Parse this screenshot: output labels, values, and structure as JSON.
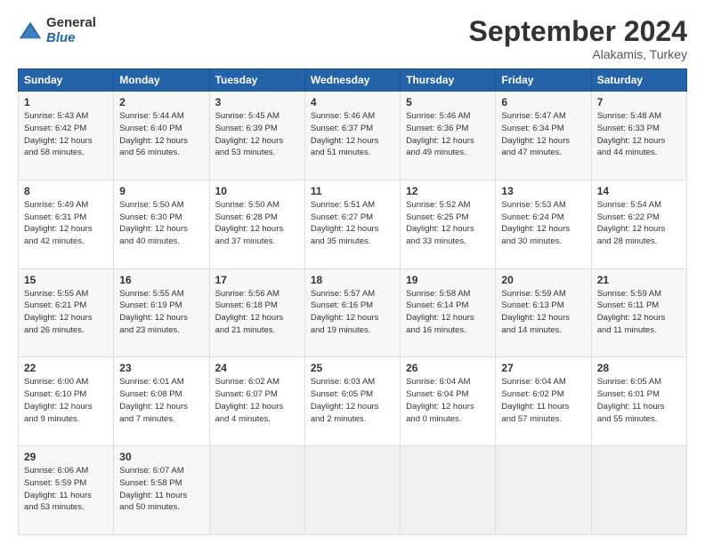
{
  "header": {
    "logo_general": "General",
    "logo_blue": "Blue",
    "month": "September 2024",
    "location": "Alakamis, Turkey"
  },
  "columns": [
    "Sunday",
    "Monday",
    "Tuesday",
    "Wednesday",
    "Thursday",
    "Friday",
    "Saturday"
  ],
  "weeks": [
    [
      {
        "day": "1",
        "lines": [
          "Sunrise: 5:43 AM",
          "Sunset: 6:42 PM",
          "Daylight: 12 hours",
          "and 58 minutes."
        ]
      },
      {
        "day": "2",
        "lines": [
          "Sunrise: 5:44 AM",
          "Sunset: 6:40 PM",
          "Daylight: 12 hours",
          "and 56 minutes."
        ]
      },
      {
        "day": "3",
        "lines": [
          "Sunrise: 5:45 AM",
          "Sunset: 6:39 PM",
          "Daylight: 12 hours",
          "and 53 minutes."
        ]
      },
      {
        "day": "4",
        "lines": [
          "Sunrise: 5:46 AM",
          "Sunset: 6:37 PM",
          "Daylight: 12 hours",
          "and 51 minutes."
        ]
      },
      {
        "day": "5",
        "lines": [
          "Sunrise: 5:46 AM",
          "Sunset: 6:36 PM",
          "Daylight: 12 hours",
          "and 49 minutes."
        ]
      },
      {
        "day": "6",
        "lines": [
          "Sunrise: 5:47 AM",
          "Sunset: 6:34 PM",
          "Daylight: 12 hours",
          "and 47 minutes."
        ]
      },
      {
        "day": "7",
        "lines": [
          "Sunrise: 5:48 AM",
          "Sunset: 6:33 PM",
          "Daylight: 12 hours",
          "and 44 minutes."
        ]
      }
    ],
    [
      {
        "day": "8",
        "lines": [
          "Sunrise: 5:49 AM",
          "Sunset: 6:31 PM",
          "Daylight: 12 hours",
          "and 42 minutes."
        ]
      },
      {
        "day": "9",
        "lines": [
          "Sunrise: 5:50 AM",
          "Sunset: 6:30 PM",
          "Daylight: 12 hours",
          "and 40 minutes."
        ]
      },
      {
        "day": "10",
        "lines": [
          "Sunrise: 5:50 AM",
          "Sunset: 6:28 PM",
          "Daylight: 12 hours",
          "and 37 minutes."
        ]
      },
      {
        "day": "11",
        "lines": [
          "Sunrise: 5:51 AM",
          "Sunset: 6:27 PM",
          "Daylight: 12 hours",
          "and 35 minutes."
        ]
      },
      {
        "day": "12",
        "lines": [
          "Sunrise: 5:52 AM",
          "Sunset: 6:25 PM",
          "Daylight: 12 hours",
          "and 33 minutes."
        ]
      },
      {
        "day": "13",
        "lines": [
          "Sunrise: 5:53 AM",
          "Sunset: 6:24 PM",
          "Daylight: 12 hours",
          "and 30 minutes."
        ]
      },
      {
        "day": "14",
        "lines": [
          "Sunrise: 5:54 AM",
          "Sunset: 6:22 PM",
          "Daylight: 12 hours",
          "and 28 minutes."
        ]
      }
    ],
    [
      {
        "day": "15",
        "lines": [
          "Sunrise: 5:55 AM",
          "Sunset: 6:21 PM",
          "Daylight: 12 hours",
          "and 26 minutes."
        ]
      },
      {
        "day": "16",
        "lines": [
          "Sunrise: 5:55 AM",
          "Sunset: 6:19 PM",
          "Daylight: 12 hours",
          "and 23 minutes."
        ]
      },
      {
        "day": "17",
        "lines": [
          "Sunrise: 5:56 AM",
          "Sunset: 6:18 PM",
          "Daylight: 12 hours",
          "and 21 minutes."
        ]
      },
      {
        "day": "18",
        "lines": [
          "Sunrise: 5:57 AM",
          "Sunset: 6:16 PM",
          "Daylight: 12 hours",
          "and 19 minutes."
        ]
      },
      {
        "day": "19",
        "lines": [
          "Sunrise: 5:58 AM",
          "Sunset: 6:14 PM",
          "Daylight: 12 hours",
          "and 16 minutes."
        ]
      },
      {
        "day": "20",
        "lines": [
          "Sunrise: 5:59 AM",
          "Sunset: 6:13 PM",
          "Daylight: 12 hours",
          "and 14 minutes."
        ]
      },
      {
        "day": "21",
        "lines": [
          "Sunrise: 5:59 AM",
          "Sunset: 6:11 PM",
          "Daylight: 12 hours",
          "and 11 minutes."
        ]
      }
    ],
    [
      {
        "day": "22",
        "lines": [
          "Sunrise: 6:00 AM",
          "Sunset: 6:10 PM",
          "Daylight: 12 hours",
          "and 9 minutes."
        ]
      },
      {
        "day": "23",
        "lines": [
          "Sunrise: 6:01 AM",
          "Sunset: 6:08 PM",
          "Daylight: 12 hours",
          "and 7 minutes."
        ]
      },
      {
        "day": "24",
        "lines": [
          "Sunrise: 6:02 AM",
          "Sunset: 6:07 PM",
          "Daylight: 12 hours",
          "and 4 minutes."
        ]
      },
      {
        "day": "25",
        "lines": [
          "Sunrise: 6:03 AM",
          "Sunset: 6:05 PM",
          "Daylight: 12 hours",
          "and 2 minutes."
        ]
      },
      {
        "day": "26",
        "lines": [
          "Sunrise: 6:04 AM",
          "Sunset: 6:04 PM",
          "Daylight: 12 hours",
          "and 0 minutes."
        ]
      },
      {
        "day": "27",
        "lines": [
          "Sunrise: 6:04 AM",
          "Sunset: 6:02 PM",
          "Daylight: 11 hours",
          "and 57 minutes."
        ]
      },
      {
        "day": "28",
        "lines": [
          "Sunrise: 6:05 AM",
          "Sunset: 6:01 PM",
          "Daylight: 11 hours",
          "and 55 minutes."
        ]
      }
    ],
    [
      {
        "day": "29",
        "lines": [
          "Sunrise: 6:06 AM",
          "Sunset: 5:59 PM",
          "Daylight: 11 hours",
          "and 53 minutes."
        ]
      },
      {
        "day": "30",
        "lines": [
          "Sunrise: 6:07 AM",
          "Sunset: 5:58 PM",
          "Daylight: 11 hours",
          "and 50 minutes."
        ]
      },
      {
        "day": "",
        "lines": []
      },
      {
        "day": "",
        "lines": []
      },
      {
        "day": "",
        "lines": []
      },
      {
        "day": "",
        "lines": []
      },
      {
        "day": "",
        "lines": []
      }
    ]
  ]
}
